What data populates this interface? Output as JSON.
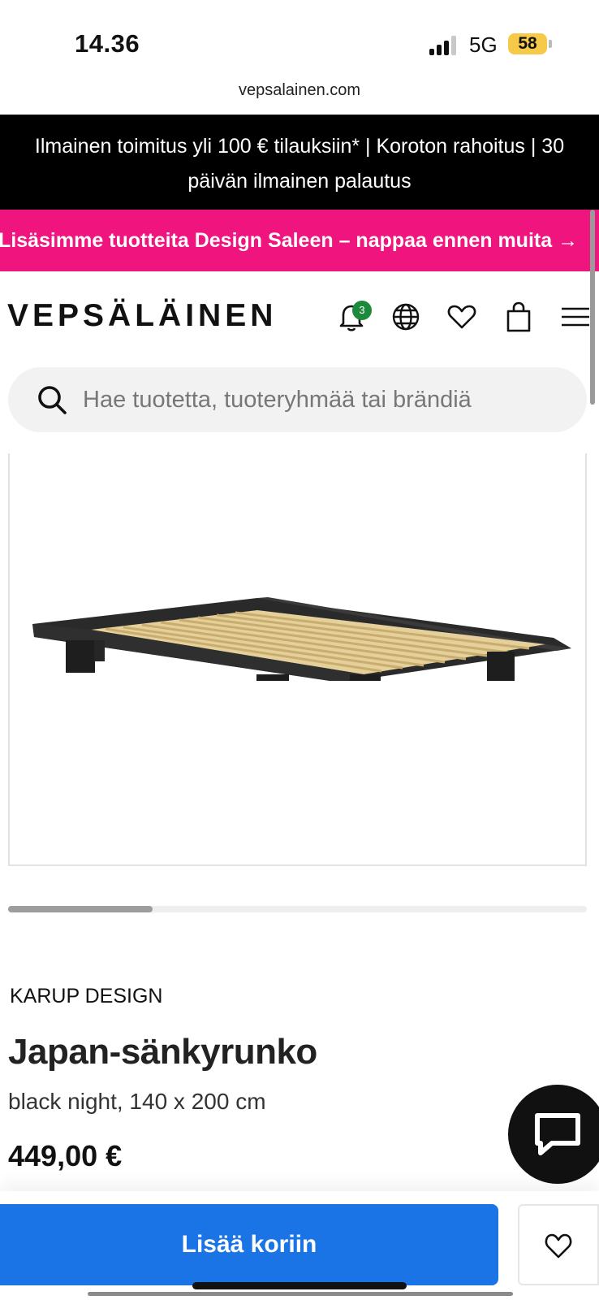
{
  "status_bar": {
    "time": "14.36",
    "network": "5G",
    "battery": "58"
  },
  "browser": {
    "url": "vepsalainen.com"
  },
  "promo": {
    "top_text": "Ilmainen toimitus yli 100 € tilauksiin* | Koroton rahoitus | 30 päivän ilmainen palautus",
    "pink_text": "Lisäsimme tuotteita Design Saleen – nappaa ennen muita →"
  },
  "header": {
    "logo": "VEPSÄLÄINEN",
    "notification_count": "3"
  },
  "search": {
    "placeholder": "Hae tuotetta, tuoteryhmää tai brändiä"
  },
  "gallery": {
    "progress": 0.25
  },
  "product": {
    "brand": "KARUP DESIGN",
    "title": "Japan-sänkyrunko",
    "variant": "black night, 140 x 200 cm",
    "price": "449,00 €"
  },
  "actions": {
    "add_to_cart": "Lisää koriin"
  },
  "icons": [
    "bell-icon",
    "globe-icon",
    "heart-icon",
    "shopping-bag-icon",
    "menu-icon",
    "search-icon",
    "chat-icon"
  ],
  "colors": {
    "promo_black": "#000000",
    "promo_pink": "#f0147e",
    "primary_button": "#1a74e6",
    "badge": "#1c8a3a",
    "battery": "#f7c948"
  }
}
